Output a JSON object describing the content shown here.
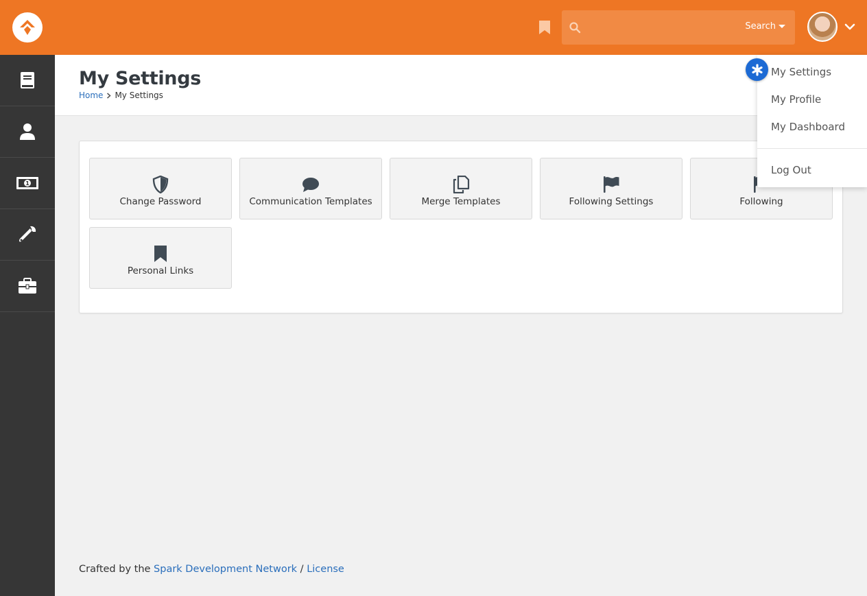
{
  "colors": {
    "brand": "#ee7624",
    "link": "#2a6ebb",
    "sidebar": "#363636",
    "badge": "#1c6ad4"
  },
  "header": {
    "search": {
      "placeholder": "",
      "button_label": "Search"
    }
  },
  "sidebar": {
    "items": [
      {
        "icon": "book-icon"
      },
      {
        "icon": "user-icon"
      },
      {
        "icon": "money-icon"
      },
      {
        "icon": "wrench-icon"
      },
      {
        "icon": "briefcase-icon"
      }
    ]
  },
  "page": {
    "title": "My Settings",
    "breadcrumb": [
      "Home",
      "My Settings"
    ]
  },
  "tiles": [
    {
      "label": "Change Password",
      "icon": "shield-icon"
    },
    {
      "label": "Communication Templates",
      "icon": "comment-icon"
    },
    {
      "label": "Merge Templates",
      "icon": "copy-icon"
    },
    {
      "label": "Following Settings",
      "icon": "flag-icon"
    },
    {
      "label": "Following",
      "icon": "flag-icon"
    },
    {
      "label": "Personal Links",
      "icon": "bookmark-icon"
    }
  ],
  "user_menu": {
    "items": [
      "My Settings",
      "My Profile",
      "My Dashboard"
    ],
    "logout": "Log Out"
  },
  "footer": {
    "prefix": "Crafted by the ",
    "link1": "Spark Development Network",
    "sep": " / ",
    "link2": "License"
  }
}
